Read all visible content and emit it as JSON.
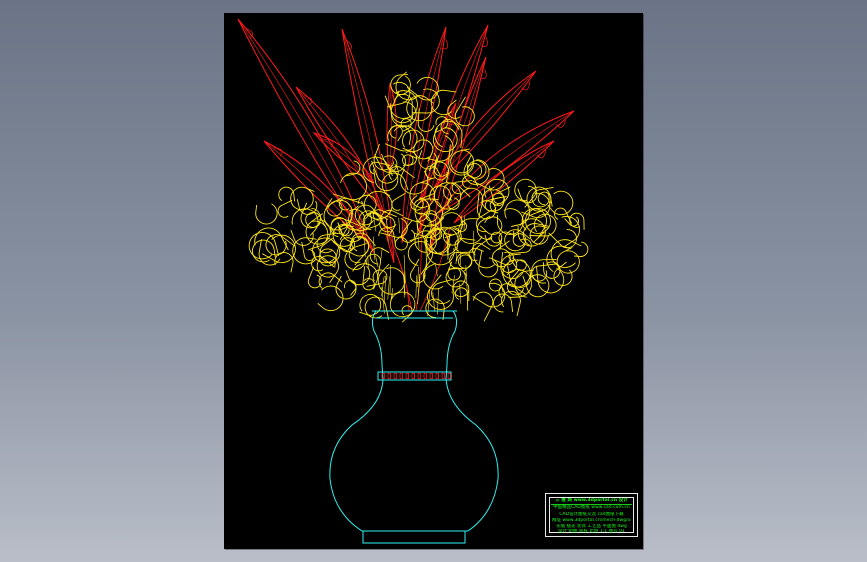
{
  "viewer": {
    "background_top": "#6b7486",
    "background_bottom": "#b9bec8"
  },
  "drawing": {
    "background": "#000000",
    "colors": {
      "leaf": "#ff1a1a",
      "curls": "#ffe51a",
      "vase": "#2ef2f2",
      "title_text": "#19ff19",
      "title_border": "#e9e9e9"
    },
    "title_block": {
      "line1": "三 维 网  www.3dportal.cn  设计",
      "line2": "中国精品CAD图纸 www.cad.com.cn",
      "line3": "CAD设计图纸交流 cad图纸下载",
      "line4": "网址 www.3dportal.cn/mech-dwg/vase",
      "line5": "花瓶 插花 装饰 工艺品 平面图 dwg",
      "line6": "设计 制图 审核 比例 1:1  图号 01"
    }
  }
}
